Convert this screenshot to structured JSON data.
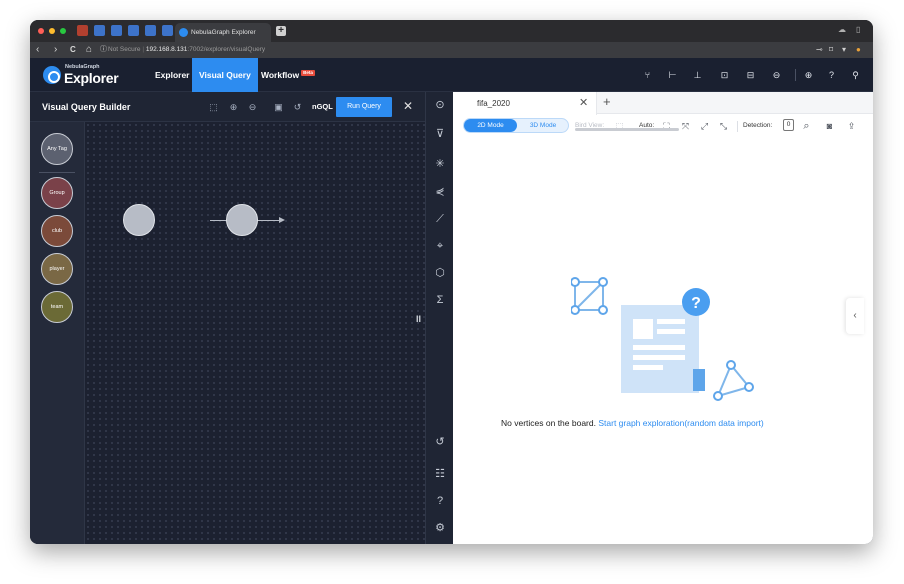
{
  "browser": {
    "tab_title": "NebulaGraph Explorer",
    "new_tab_glyph": "+",
    "security_label": "Not Secure",
    "url_host": "192.168.8.131",
    "url_path": ":7002/explorer/visualQuery",
    "nav_back_glyph": "‹",
    "nav_forward_glyph": "›",
    "reload_glyph": "C",
    "home_glyph": "⌂"
  },
  "app": {
    "logo_small": "NebulaGraph",
    "logo_big": "Explorer",
    "nav": {
      "explorer": "Explorer",
      "visual_query": "Visual Query",
      "workflow": "Workflow",
      "workflow_badge": "Beta"
    },
    "brand_color": "#2d8cf0"
  },
  "builder": {
    "title": "Visual Query Builder",
    "ngql_label": "nGQL",
    "run_label": "Run Query",
    "close_glyph": "✕",
    "tags": [
      {
        "label": "Any Tag",
        "color": "#5c6170"
      },
      {
        "label": "Group",
        "color": "#7a4149"
      },
      {
        "label": "club",
        "color": "#7b4a3a"
      },
      {
        "label": "player",
        "color": "#7a6845"
      },
      {
        "label": "team",
        "color": "#6b6a36"
      }
    ]
  },
  "canvas_tab": {
    "name": "fifa_2020",
    "close_glyph": "✕",
    "add_glyph": "+"
  },
  "view_toolbar": {
    "mode_2d": "2D Mode",
    "mode_3d": "3D Mode",
    "bird_view": "Bird View:",
    "auto": "Auto:",
    "detection": "Detection:",
    "detection_value": "0"
  },
  "empty_state": {
    "message": "No vertices on the board.",
    "link": "Start graph exploration(random data import)",
    "badge_glyph": "?"
  },
  "glyphs": {
    "drag_handle": "II",
    "side_collapse": "‹"
  }
}
